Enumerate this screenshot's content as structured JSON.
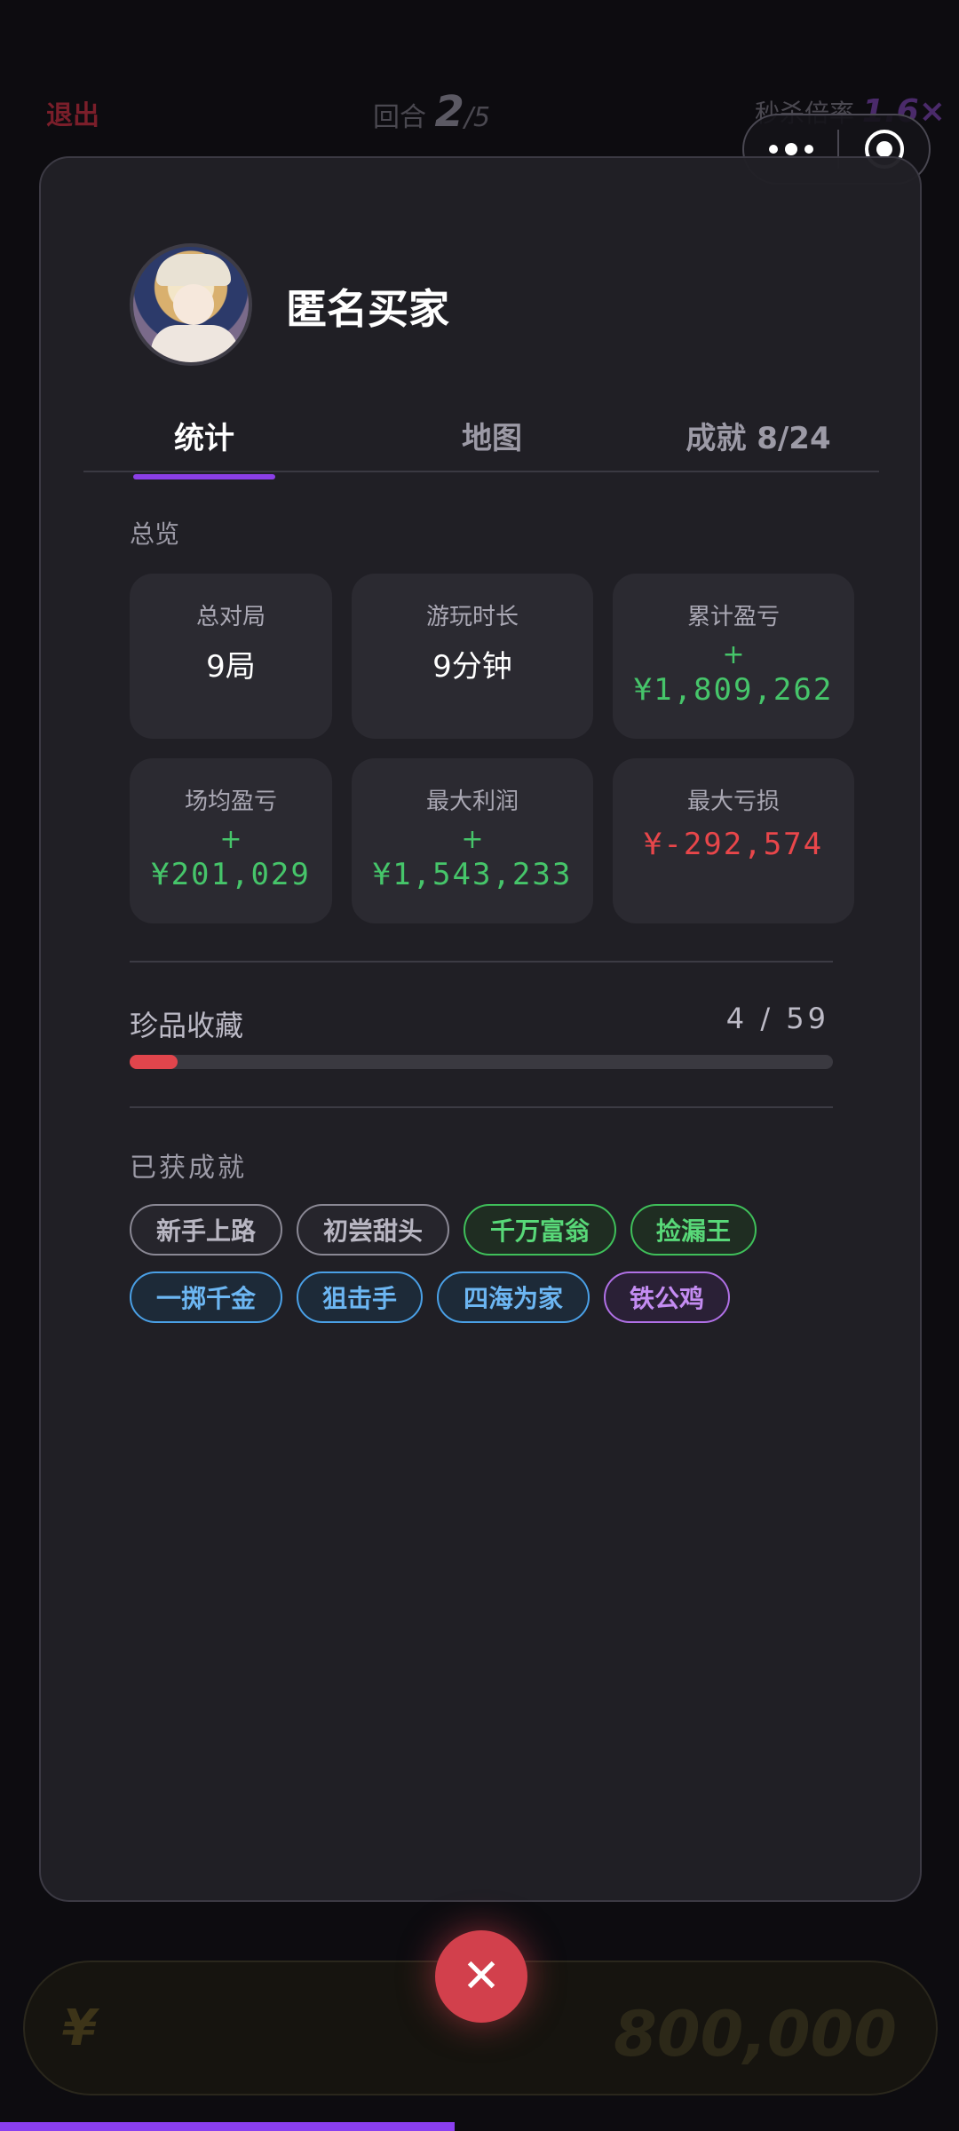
{
  "background": {
    "exit_label": "退出",
    "round_label": "回合",
    "round_current": "2",
    "round_total": "/5",
    "rate_label": "秒杀倍率",
    "rate_value": "1.6×",
    "bid_currency": "¥",
    "bid_amount": "800,000"
  },
  "capsule": {
    "more_icon": "more-dots-icon",
    "target_icon": "target-icon"
  },
  "profile": {
    "username": "匿名买家"
  },
  "tabs": [
    {
      "label": "统计",
      "active": true
    },
    {
      "label": "地图",
      "active": false
    },
    {
      "label": "成就 8/24",
      "active": false
    }
  ],
  "overview": {
    "title": "总览",
    "stats": [
      {
        "label": "总对局",
        "value": "9局"
      },
      {
        "label": "游玩时长",
        "value": "9分钟"
      },
      {
        "label": "累计盈亏",
        "sign": "+",
        "value": "¥1,809,262",
        "tone": "positive"
      },
      {
        "label": "场均盈亏",
        "sign": "+",
        "value": "¥201,029",
        "tone": "positive"
      },
      {
        "label": "最大利润",
        "sign": "+",
        "value": "¥1,543,233",
        "tone": "positive"
      },
      {
        "label": "最大亏损",
        "value": "¥-292,574",
        "tone": "negative"
      }
    ]
  },
  "collection": {
    "label": "珍品收藏",
    "count": "4  /  59",
    "progress_fraction": 0.0678
  },
  "achievements": {
    "title": "已获成就",
    "badges": [
      {
        "label": "新手上路",
        "tier": "gray"
      },
      {
        "label": "初尝甜头",
        "tier": "gray"
      },
      {
        "label": "千万富翁",
        "tier": "green"
      },
      {
        "label": "捡漏王",
        "tier": "green"
      },
      {
        "label": "一掷千金",
        "tier": "blue"
      },
      {
        "label": "狙击手",
        "tier": "blue"
      },
      {
        "label": "四海为家",
        "tier": "blue"
      },
      {
        "label": "铁公鸡",
        "tier": "purple"
      }
    ]
  },
  "close_icon": "close-icon",
  "colors": {
    "accent": "#8b3fe6",
    "positive": "#46c56a",
    "negative": "#e8464a",
    "close_button": "#d2404c"
  }
}
